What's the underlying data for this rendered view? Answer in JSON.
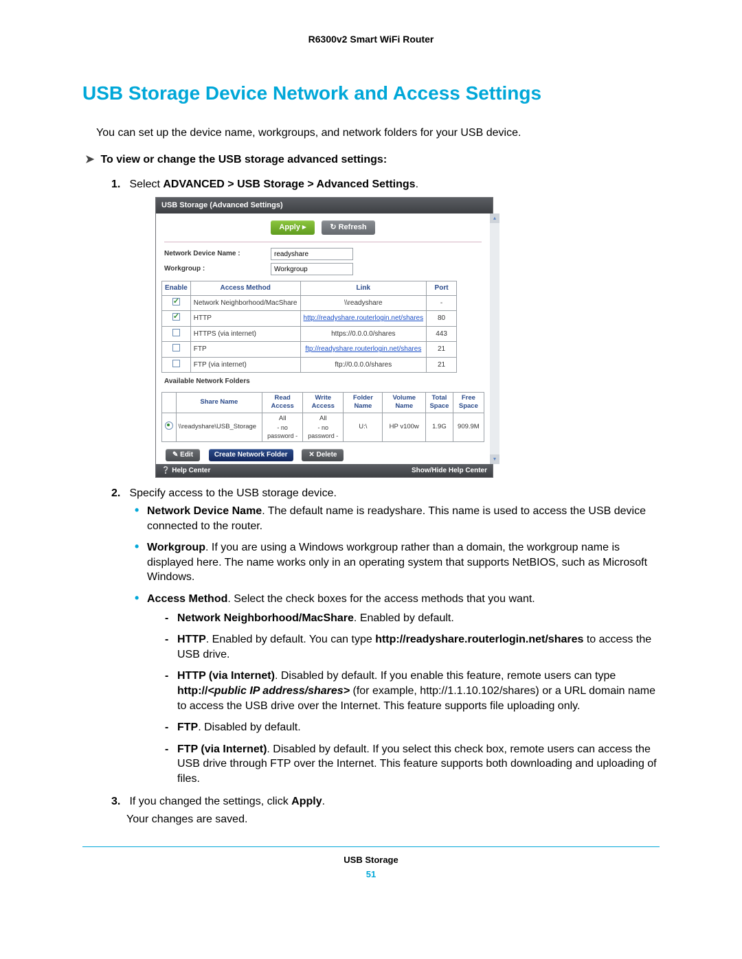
{
  "header": {
    "product": "R6300v2 Smart WiFi Router"
  },
  "title": "USB Storage Device Network and Access Settings",
  "intro": "You can set up the device name, workgroups, and network folders for your USB device.",
  "subheading": "To view or change the USB storage advanced settings:",
  "steps": {
    "s1": {
      "num": "1.",
      "prefix": "Select ",
      "path": "ADVANCED > USB Storage > Advanced Settings",
      "suffix": "."
    },
    "s2": {
      "num": "2.",
      "text": "Specify access to the USB storage device."
    },
    "s3": {
      "num": "3.",
      "prefix": "If you changed the settings, click ",
      "bold": "Apply",
      "suffix": ".",
      "result": "Your changes are saved."
    }
  },
  "bullets": {
    "ndn_bold": "Network Device Name",
    "ndn_text": ". The default name is readyshare. This name is used to access the USB device connected to the router.",
    "wg_bold": "Workgroup",
    "wg_text": ". If you are using a Windows workgroup rather than a domain, the workgroup name is displayed here. The name works only in an operating system that supports NetBIOS, such as Microsoft Windows.",
    "am_bold": "Access Method",
    "am_text": ". Select the check boxes for the access methods that you want."
  },
  "dashes": {
    "d1_bold": "Network Neighborhood/MacShare",
    "d1_text": ". Enabled by default.",
    "d2_bold": "HTTP",
    "d2_text1": ". Enabled by default. You can type ",
    "d2_bold2": "http://readyshare.routerlogin.net/shares",
    "d2_text2": " to access the USB drive.",
    "d3_bold": "HTTP (via Internet)",
    "d3_text1": ". Disabled by default. If you enable this feature, remote users can type ",
    "d3_bold2": "http://",
    "d3_ital": "<public IP address/shares>",
    "d3_text2": " (for example, http://1.1.10.102/shares) or a URL domain name to access the USB drive over the Internet. This feature supports file uploading only.",
    "d4_bold": "FTP",
    "d4_text": ". Disabled by default.",
    "d5_bold": "FTP (via Internet)",
    "d5_text": ". Disabled by default. If you select this check box, remote users can access the USB drive through FTP over the Internet. This feature supports both downloading and uploading of files."
  },
  "panel": {
    "title": "USB Storage (Advanced Settings)",
    "apply": "Apply ▸",
    "refresh": "↻ Refresh",
    "ndn_label": "Network Device Name :",
    "ndn_value": "readyshare",
    "wg_label": "Workgroup :",
    "wg_value": "Workgroup",
    "access": {
      "h_enable": "Enable",
      "h_method": "Access Method",
      "h_link": "Link",
      "h_port": "Port",
      "rows": [
        {
          "on": true,
          "method": "Network Neighborhood/MacShare",
          "link": "\\\\readyshare",
          "islink": false,
          "port": "-"
        },
        {
          "on": true,
          "method": "HTTP",
          "link": "http://readyshare.routerlogin.net/shares",
          "islink": true,
          "port": "80"
        },
        {
          "on": false,
          "method": "HTTPS (via internet)",
          "link": "https://0.0.0.0/shares",
          "islink": false,
          "port": "443"
        },
        {
          "on": false,
          "method": "FTP",
          "link": "ftp://readyshare.routerlogin.net/shares",
          "islink": true,
          "port": "21"
        },
        {
          "on": false,
          "method": "FTP (via internet)",
          "link": "ftp://0.0.0.0/shares",
          "islink": false,
          "port": "21"
        }
      ]
    },
    "folders": {
      "heading": "Available Network Folders",
      "h_share": "Share Name",
      "h_read": "Read Access",
      "h_write": "Write Access",
      "h_folder": "Folder Name",
      "h_vol": "Volume Name",
      "h_total": "Total Space",
      "h_free": "Free Space",
      "row": {
        "share": "\\\\readyshare\\USB_Storage",
        "read": "All",
        "read_sub": "- no password -",
        "write": "All",
        "write_sub": "- no password -",
        "folder": "U:\\",
        "vol": "HP v100w",
        "total": "1.9G",
        "free": "909.9M"
      }
    },
    "actions": {
      "edit": "✎ Edit",
      "create": "Create Network Folder",
      "delete": "✕ Delete"
    },
    "footer": {
      "help": "Help Center",
      "toggle": "Show/Hide Help Center"
    }
  },
  "footer": {
    "section": "USB Storage",
    "page": "51"
  }
}
